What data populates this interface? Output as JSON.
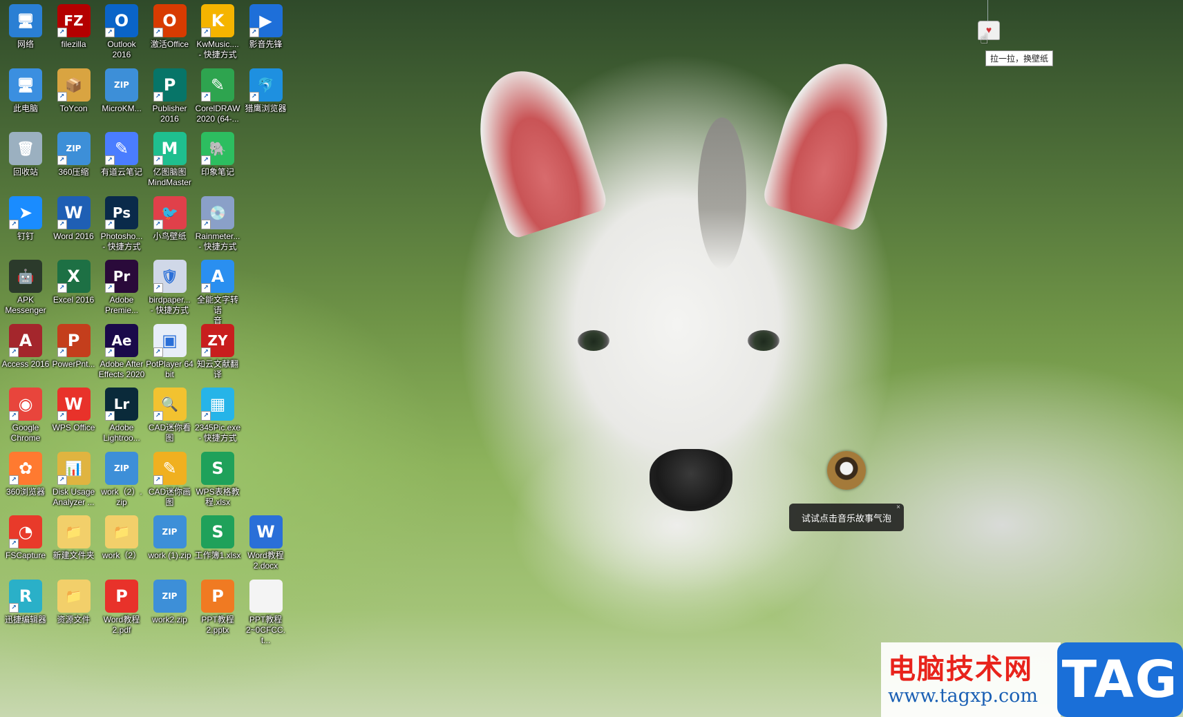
{
  "desktop": {
    "icons": [
      {
        "label": "网络",
        "icon": "network-icon",
        "symbol": "🖥",
        "bg": "#2a7fd4",
        "shortcut": false
      },
      {
        "label": "filezilla",
        "icon": "filezilla-icon",
        "symbol": "FZ",
        "bg": "#b40000",
        "shortcut": true
      },
      {
        "label": "Outlook\n2016",
        "icon": "outlook-icon",
        "symbol": "O",
        "bg": "#0a64c8",
        "shortcut": true
      },
      {
        "label": "激活Office",
        "icon": "office-icon",
        "symbol": "O",
        "bg": "#d83b01",
        "shortcut": true
      },
      {
        "label": "KwMusic....\n- 快捷方式",
        "icon": "kwmusic-icon",
        "symbol": "K",
        "bg": "#f5b400",
        "shortcut": true
      },
      {
        "label": "影音先锋",
        "icon": "player-icon",
        "symbol": "▶",
        "bg": "#1e6fd9",
        "shortcut": true
      },
      {
        "label": "此电脑",
        "icon": "computer-icon",
        "symbol": "🖥",
        "bg": "#3b8fe0",
        "shortcut": false
      },
      {
        "label": "ToYcon",
        "icon": "toycon-icon",
        "symbol": "📦",
        "bg": "#d9a441",
        "shortcut": true
      },
      {
        "label": "MicroKM...",
        "icon": "zip-archive-icon",
        "symbol": "ZIP",
        "bg": "#3d8fd8",
        "shortcut": false
      },
      {
        "label": "Publisher\n2016",
        "icon": "publisher-icon",
        "symbol": "P",
        "bg": "#077568",
        "shortcut": true
      },
      {
        "label": "CorelDRAW\n2020 (64-...",
        "icon": "coreldraw-icon",
        "symbol": "✎",
        "bg": "#2ea44f",
        "shortcut": true
      },
      {
        "label": "猎鹰浏览器",
        "icon": "falcon-browser-icon",
        "symbol": "🐬",
        "bg": "#1e90e0",
        "shortcut": true
      },
      {
        "label": "回收站",
        "icon": "recycle-bin-icon",
        "symbol": "🗑",
        "bg": "#9bb0c0",
        "shortcut": false
      },
      {
        "label": "360压缩",
        "icon": "zip-archive-icon",
        "symbol": "ZIP",
        "bg": "#3d8fd8",
        "shortcut": true
      },
      {
        "label": "有道云笔记",
        "icon": "youdao-note-icon",
        "symbol": "✎",
        "bg": "#4a7dff",
        "shortcut": true
      },
      {
        "label": "亿图脑图\nMindMaster",
        "icon": "mindmaster-icon",
        "symbol": "M",
        "bg": "#1fbf8f",
        "shortcut": true
      },
      {
        "label": "印象笔记",
        "icon": "evernote-icon",
        "symbol": "🐘",
        "bg": "#2dbe60",
        "shortcut": true
      },
      {
        "label": "钉钉",
        "icon": "dingtalk-icon",
        "symbol": "➤",
        "bg": "#1a8cff",
        "shortcut": true
      },
      {
        "label": "Word 2016",
        "icon": "word-icon",
        "symbol": "W",
        "bg": "#1f5fb4",
        "shortcut": true
      },
      {
        "label": "Photosho...\n- 快捷方式",
        "icon": "photoshop-icon",
        "symbol": "Ps",
        "bg": "#0a2a4a",
        "shortcut": true
      },
      {
        "label": "小鸟壁纸",
        "icon": "bird-wallpaper-icon",
        "symbol": "🐦",
        "bg": "#e0404a",
        "shortcut": true
      },
      {
        "label": "Rainmeter...\n- 快捷方式",
        "icon": "rainmeter-icon",
        "symbol": "💿",
        "bg": "#8aa0c8",
        "shortcut": true
      },
      {
        "label": "APK\nMessenger",
        "icon": "apk-messenger-icon",
        "symbol": "🤖",
        "bg": "#2b3a2b",
        "shortcut": false
      },
      {
        "label": "Excel 2016",
        "icon": "excel-icon",
        "symbol": "X",
        "bg": "#1d7044",
        "shortcut": true
      },
      {
        "label": "Adobe\nPremie...",
        "icon": "premiere-icon",
        "symbol": "Pr",
        "bg": "#2a0a3a",
        "shortcut": true
      },
      {
        "label": "birdpaper...\n- 快捷方式",
        "icon": "birdpaper-icon",
        "symbol": "🛡",
        "bg": "#d0d8e8",
        "shortcut": true
      },
      {
        "label": "全能文字转语\n音",
        "icon": "text-to-speech-icon",
        "symbol": "A",
        "bg": "#2a8ff0",
        "shortcut": true
      },
      {
        "label": "Access 2016",
        "icon": "access-icon",
        "symbol": "A",
        "bg": "#a4262c",
        "shortcut": true
      },
      {
        "label": "PowerPnt...",
        "icon": "powerpoint-icon",
        "symbol": "P",
        "bg": "#c43e1c",
        "shortcut": true
      },
      {
        "label": "Adobe After\nEffects 2020",
        "icon": "after-effects-icon",
        "symbol": "Ae",
        "bg": "#1a0a4a",
        "shortcut": true
      },
      {
        "label": "PotPlayer 64\nbit",
        "icon": "potplayer-icon",
        "symbol": "▣",
        "bg": "#e8eef8",
        "shortcut": true
      },
      {
        "label": "知云文献翻译",
        "icon": "zhiyun-translate-icon",
        "symbol": "ZY",
        "bg": "#c81e1e",
        "shortcut": true
      },
      {
        "label": "Google\nChrome",
        "icon": "chrome-icon",
        "symbol": "◉",
        "bg": "#e8453c",
        "shortcut": true
      },
      {
        "label": "WPS Office",
        "icon": "wps-office-icon",
        "symbol": "W",
        "bg": "#e8322a",
        "shortcut": true
      },
      {
        "label": "Adobe\nLightroo...",
        "icon": "lightroom-icon",
        "symbol": "Lr",
        "bg": "#0a2a3a",
        "shortcut": true
      },
      {
        "label": "CAD迷你看\n图",
        "icon": "cad-viewer-icon",
        "symbol": "🔍",
        "bg": "#f2c230",
        "shortcut": true
      },
      {
        "label": "2345Pic.exe\n- 快捷方式",
        "icon": "2345pic-icon",
        "symbol": "▦",
        "bg": "#26b4e8",
        "shortcut": true
      },
      {
        "label": "360浏览器",
        "icon": "360-browser-icon",
        "symbol": "✿",
        "bg": "#ff7a30",
        "shortcut": true
      },
      {
        "label": "Disk Usage\nAnalyzer ...",
        "icon": "disk-usage-icon",
        "symbol": "📊",
        "bg": "#e0b440",
        "shortcut": true
      },
      {
        "label": "work（2）.\nzip",
        "icon": "zip-archive-icon",
        "symbol": "ZIP",
        "bg": "#3d8fd8",
        "shortcut": false
      },
      {
        "label": "CAD迷你画\n图",
        "icon": "cad-draw-icon",
        "symbol": "✎",
        "bg": "#f0b020",
        "shortcut": true
      },
      {
        "label": "WPS表格教\n程.xlsx",
        "icon": "spreadsheet-file-icon",
        "symbol": "S",
        "bg": "#1fa15a",
        "shortcut": false
      },
      {
        "label": "FSCapture",
        "icon": "fscapture-icon",
        "symbol": "◔",
        "bg": "#e83a2a",
        "shortcut": true
      },
      {
        "label": "新建文件夹",
        "icon": "folder-icon",
        "symbol": "📁",
        "bg": "#f2cf6a",
        "shortcut": false
      },
      {
        "label": "work（2）",
        "icon": "folder-icon",
        "symbol": "📁",
        "bg": "#f2cf6a",
        "shortcut": false
      },
      {
        "label": "work (1).zip",
        "icon": "zip-archive-icon",
        "symbol": "ZIP",
        "bg": "#3d8fd8",
        "shortcut": false
      },
      {
        "label": "工作簿1.xlsx",
        "icon": "spreadsheet-file-icon",
        "symbol": "S",
        "bg": "#1fa15a",
        "shortcut": false
      },
      {
        "label": "Word教程\n2.docx",
        "icon": "word-file-icon",
        "symbol": "W",
        "bg": "#2a6fd8",
        "shortcut": false
      },
      {
        "label": "迅捷编辑器",
        "icon": "editor-icon",
        "symbol": "R",
        "bg": "#2ab0c8",
        "shortcut": true
      },
      {
        "label": "资源文件",
        "icon": "folder-icon",
        "symbol": "📁",
        "bg": "#f2cf6a",
        "shortcut": false
      },
      {
        "label": "Word教程\n2.pdf",
        "icon": "pdf-file-icon",
        "symbol": "P",
        "bg": "#e8322a",
        "shortcut": false
      },
      {
        "label": "work2.zip",
        "icon": "zip-archive-icon",
        "symbol": "ZIP",
        "bg": "#3d8fd8",
        "shortcut": false
      },
      {
        "label": "PPT教程\n2.pptx",
        "icon": "pptx-file-icon",
        "symbol": "P",
        "bg": "#f07a22",
        "shortcut": false
      },
      {
        "label": "PPT教程\n2~0CFCC.t...",
        "icon": "blank-file-icon",
        "symbol": "",
        "bg": "#f4f4f4",
        "shortcut": false
      }
    ]
  },
  "wallpaper_widget": {
    "tooltip": "拉一拉，换壁纸",
    "icon": "shirt-icon"
  },
  "music_bubble": {
    "text": "试试点击音乐故事气泡",
    "close_symbol": "×"
  },
  "watermark": {
    "title": "电脑技术网",
    "url": "www.tagxp.com",
    "badge": "TAG"
  }
}
